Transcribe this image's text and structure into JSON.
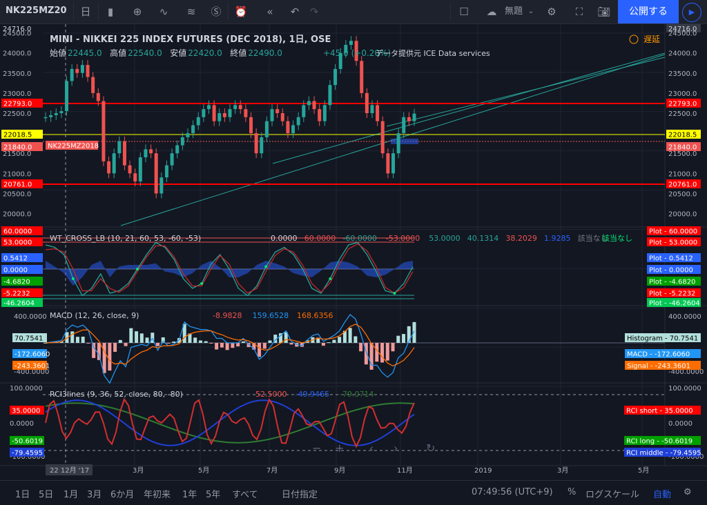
{
  "toolbar": {
    "symbol": "NK225MZ20",
    "interval": "日",
    "template_label": "無題",
    "publish_label": "公開する"
  },
  "header": {
    "title": "MINI - NIKKEI 225 INDEX FUTURES (DEC 2018), 1日, OSE",
    "ohlc": [
      {
        "label": "始値",
        "value": "22445.0"
      },
      {
        "label": "高値",
        "value": "22540.0"
      },
      {
        "label": "安値",
        "value": "22420.0"
      },
      {
        "label": "終値",
        "value": "22490.0"
      }
    ],
    "change": "+45.0 (+0.20%)",
    "provider": "データ提供元 ICE Data services",
    "delay_label": "遅延"
  },
  "axis": {
    "price_ticks": [
      "24500.0",
      "24000.0",
      "23500.0",
      "23000.0",
      "22500.0",
      "22000.0",
      "21500.0",
      "21000.0",
      "20500.0",
      "20000.0"
    ],
    "top_price": "24716.0",
    "lines": {
      "upper_red": "22793.0",
      "yellow": "22018.5",
      "current": "21840.0",
      "lower_red": "20761.0"
    },
    "symbol_tag": "NK225MZ2018",
    "x_labels": [
      "22 12月 '17",
      "3月",
      "5月",
      "7月",
      "9月",
      "11月",
      "2019",
      "3月",
      "5月"
    ]
  },
  "wt_panel": {
    "title": "WT_CROSS_LB (10, 21, 60, 53, -60, -53)",
    "values": [
      "0.0000",
      "60.0000",
      "-60.0000",
      "-53.0000",
      "53.0000",
      "40.1314",
      "38.2029",
      "1.9285",
      "該当なし",
      "該当なし"
    ],
    "left_tags": [
      "60.0000",
      "53.0000",
      "0.5412",
      "0.0000",
      "-4.6820",
      "-5.2232",
      "-46.2604"
    ],
    "right_tags": [
      "Plot - 60.0000",
      "Plot - 53.0000",
      "Plot - 0.5412",
      "Plot - 0.0000",
      "Plot - -4.6820",
      "Plot - -5.2232",
      "Plot - -46.2604"
    ]
  },
  "macd_panel": {
    "title": "MACD (12, 26, close, 9)",
    "values": [
      "-8.9828",
      "159.6528",
      "168.6356"
    ],
    "ticks": [
      "400.0000",
      "-400.0000"
    ],
    "left_tags": [
      "70.7541",
      "-172.6060",
      "-243.3601"
    ],
    "right_tags": [
      "Histogram - 70.7541",
      "MACD - -172.6060",
      "Signal - -243.3601"
    ],
    "right_ticks": [
      "400.0000",
      "-400.0000"
    ]
  },
  "rci_panel": {
    "title": "RCI3lines (9, 36, 52, close, 80, -80)",
    "values": [
      "52.5000",
      "-49.9465",
      "-79.0714"
    ],
    "ticks": [
      "100.0000",
      "0.0000",
      "-100.0000"
    ],
    "left_tags": [
      "35.0000",
      "-50.6019",
      "-79.4595"
    ],
    "right_tags": [
      "RCI short - 35.0000",
      "RCI long - -50.6019",
      "RCI middle - -79.4595"
    ]
  },
  "bottom": {
    "ranges": [
      "1日",
      "5日",
      "1月",
      "3月",
      "6か月",
      "年初来",
      "1年",
      "5年",
      "すべて"
    ],
    "date_goto": "日付指定",
    "time": "07:49:56 (UTC+9)",
    "percent": "%",
    "log": "ログスケール",
    "auto": "自動"
  },
  "colors": {
    "up": "#26a69a",
    "down": "#ef5350",
    "red_line": "#ff0000",
    "yellow_line": "#ffff00",
    "accent": "#2962ff"
  },
  "chart_data": [
    {
      "type": "candlestick",
      "title": "MINI - NIKKEI 225 INDEX FUTURES (DEC 2018), 1日, OSE",
      "ylim": [
        19700,
        24716
      ],
      "series": [
        {
          "values": [
            22400,
            22450,
            22500,
            22550,
            23300,
            23600,
            23500,
            23700,
            23400,
            23000,
            22800,
            21300,
            21000,
            21500,
            21800,
            21200,
            21000,
            20800,
            21400,
            21600,
            21500,
            20500,
            20900,
            21200,
            21500,
            21700,
            21900,
            22000,
            22200,
            22400,
            22600,
            22700,
            22300,
            22500,
            22400,
            22600,
            22700,
            22600,
            22400,
            22000,
            21500,
            21900,
            22300,
            22600,
            22500,
            22300,
            22000,
            22200,
            22400,
            22700,
            22800,
            22600,
            22300,
            22700,
            23200,
            23600,
            24000,
            24200,
            24300,
            23800,
            23000,
            22500,
            22700,
            22300,
            21500,
            21000,
            21500,
            22000,
            22400,
            22300,
            22490
          ]
        }
      ]
    },
    {
      "type": "line",
      "title": "WT_CROSS_LB (10, 21, 60, 53, -60, -53)",
      "series": [
        {
          "values": [
            50,
            45,
            30,
            -20,
            -55,
            -40,
            -10,
            -50,
            -45,
            -30,
            0,
            30,
            55,
            45,
            20,
            -20,
            -40,
            -30,
            10,
            30,
            0,
            -40,
            -55,
            -35,
            5,
            35,
            45,
            30,
            0,
            -40,
            -50,
            -20,
            20,
            50,
            55,
            30,
            -5,
            -45,
            -50,
            -30,
            5
          ]
        },
        {
          "values": [
            40,
            42,
            35,
            0,
            -45,
            -45,
            -20,
            -40,
            -48,
            -35,
            -5,
            25,
            48,
            48,
            25,
            -10,
            -35,
            -35,
            0,
            28,
            10,
            -30,
            -50,
            -40,
            -5,
            28,
            42,
            35,
            8,
            -30,
            -48,
            -28,
            10,
            42,
            52,
            38,
            5,
            -38,
            -50,
            -38,
            -5
          ]
        }
      ]
    },
    {
      "type": "bar+line",
      "title": "MACD (12, 26, close, 9)",
      "series": [
        {
          "name": "Histogram",
          "values": [
            70.7541
          ]
        },
        {
          "name": "MACD",
          "values": [
            -172.606
          ]
        },
        {
          "name": "Signal",
          "values": [
            -243.3601
          ]
        }
      ]
    },
    {
      "type": "line",
      "title": "RCI3lines (9, 36, 52, close, 80, -80)",
      "series": [
        {
          "name": "RCI short",
          "values": [
            35
          ]
        },
        {
          "name": "RCI long",
          "values": [
            -50.6019
          ]
        },
        {
          "name": "RCI middle",
          "values": [
            -79.4595
          ]
        }
      ]
    }
  ]
}
